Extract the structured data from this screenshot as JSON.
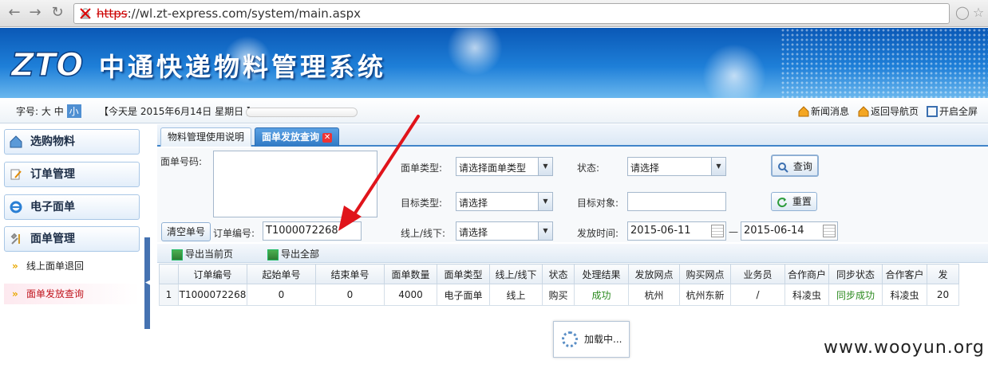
{
  "browser": {
    "url_scheme": "https",
    "url_rest": "://wl.zt-express.com/system/main.aspx"
  },
  "header": {
    "logo_text": "ZTO",
    "system_title": "中通快递物料管理系统"
  },
  "infobar": {
    "font_size_label": "字号:",
    "font_large": "大",
    "font_medium": "中",
    "font_small": "小",
    "today_text": "【今天是 2015年6月14日 星期日 】",
    "links": {
      "news": "新闻消息",
      "back_nav": "返回导航页",
      "fullscreen": "开启全屏"
    }
  },
  "sidebar": {
    "items": [
      {
        "label": "选购物料",
        "icon": "home-icon"
      },
      {
        "label": "订单管理",
        "icon": "edit-icon"
      },
      {
        "label": "电子面单",
        "icon": "ie-icon"
      },
      {
        "label": "面单管理",
        "icon": "tools-icon"
      }
    ],
    "sub_items": [
      {
        "label": "线上面单退回",
        "active": false
      },
      {
        "label": "面单发放查询",
        "active": true
      }
    ]
  },
  "tabs": [
    {
      "label": "物料管理使用说明",
      "active": false
    },
    {
      "label": "面单发放查询",
      "active": true
    }
  ],
  "form": {
    "waybill_no_label": "面单号码:",
    "waybill_no_value": "",
    "clear_button": "清空单号",
    "order_no_label": "订单编号:",
    "order_no_value": "T1000072268",
    "waybill_type_label": "面单类型:",
    "waybill_type_value": "请选择面单类型",
    "target_type_label": "目标类型:",
    "target_type_value": "请选择",
    "online_label": "线上/线下:",
    "online_value": "请选择",
    "status_label": "状态:",
    "status_value": "请选择",
    "target_obj_label": "目标对象:",
    "target_obj_value": "",
    "issue_time_label": "发放时间:",
    "date_from": "2015-06-11",
    "date_sep": "—",
    "date_to": "2015-06-14",
    "query_button": "查询",
    "reset_button": "重置"
  },
  "toolbar": {
    "export_page": "导出当前页",
    "export_all": "导出全部"
  },
  "table": {
    "columns": [
      "订单编号",
      "起始单号",
      "结束单号",
      "面单数量",
      "面单类型",
      "线上/线下",
      "状态",
      "处理结果",
      "发放网点",
      "购买网点",
      "业务员",
      "合作商户",
      "同步状态",
      "合作客户",
      "发"
    ],
    "rows": [
      {
        "rn": "1",
        "cells": [
          "T1000072268",
          "0",
          "0",
          "4000",
          "电子面单",
          "线上",
          "购买",
          "成功",
          "杭州",
          "杭州东新",
          "/",
          "科凌虫",
          "同步成功",
          "科凌虫",
          "20"
        ]
      }
    ]
  },
  "loading_text": "加载中...",
  "watermark": "www.wooyun.org",
  "colors": {
    "banner": "#1e7fd8",
    "tab_active": "#2f79c4",
    "success_text": "#2b8a1f",
    "annotation_arrow": "#e0141b"
  }
}
